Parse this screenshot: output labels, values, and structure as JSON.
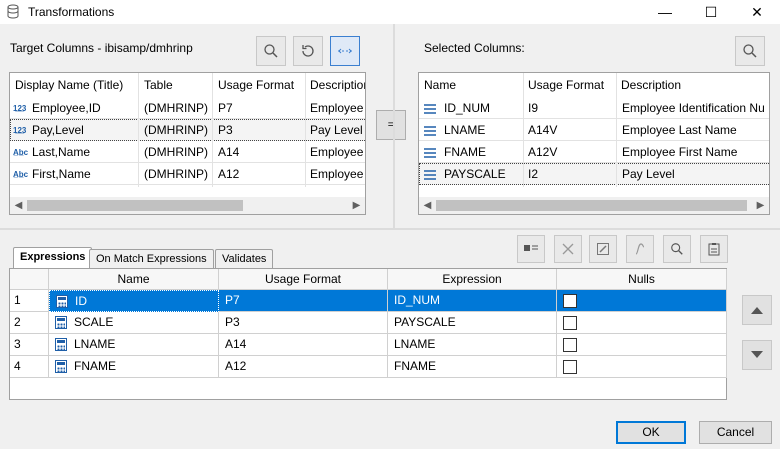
{
  "window": {
    "title": "Transformations",
    "minimize": "—",
    "maximize": "☐",
    "close": "✕"
  },
  "target": {
    "label": "Target Columns - ibisamp/dmhrinp",
    "columns": [
      "Display Name (Title)",
      "Table",
      "Usage Format",
      "Description"
    ],
    "rows": [
      {
        "name": "Employee,ID",
        "table": "(DMHRINP)",
        "format": "P7",
        "desc": "Employee",
        "icon": "123-icon"
      },
      {
        "name": "Pay,Level",
        "table": "(DMHRINP)",
        "format": "P3",
        "desc": "Pay Level",
        "icon": "123-icon"
      },
      {
        "name": "Last,Name",
        "table": "(DMHRINP)",
        "format": "A14",
        "desc": "Employee",
        "icon": "abc-icon"
      },
      {
        "name": "First,Name",
        "table": "(DMHRINP)",
        "format": "A12",
        "desc": "Employee",
        "icon": "abc-icon"
      }
    ]
  },
  "equals_label": "=",
  "selected": {
    "label": "Selected Columns:",
    "columns": [
      "Name",
      "Usage Format",
      "Description"
    ],
    "rows": [
      {
        "name": "ID_NUM",
        "format": "I9",
        "desc": "Employee Identification Nu"
      },
      {
        "name": "LNAME",
        "format": "A14V",
        "desc": "Employee Last Name"
      },
      {
        "name": "FNAME",
        "format": "A12V",
        "desc": "Employee First Name"
      },
      {
        "name": "PAYSCALE",
        "format": "I2",
        "desc": "Pay Level"
      }
    ]
  },
  "tabs": [
    "Expressions",
    "On Match Expressions",
    "Validates"
  ],
  "expressions": {
    "columns": [
      "Name",
      "Usage Format",
      "Expression",
      "Nulls"
    ],
    "rows": [
      {
        "num": "1",
        "name": "ID",
        "format": "P7",
        "expr": "ID_NUM"
      },
      {
        "num": "2",
        "name": "SCALE",
        "format": "P3",
        "expr": "PAYSCALE"
      },
      {
        "num": "3",
        "name": "LNAME",
        "format": "A14",
        "expr": "LNAME"
      },
      {
        "num": "4",
        "name": "FNAME",
        "format": "A12",
        "expr": "FNAME"
      }
    ]
  },
  "buttons": {
    "ok": "OK",
    "cancel": "Cancel"
  },
  "colors": {
    "selection": "#0078d7",
    "accent_border": "#3b7fd0"
  }
}
